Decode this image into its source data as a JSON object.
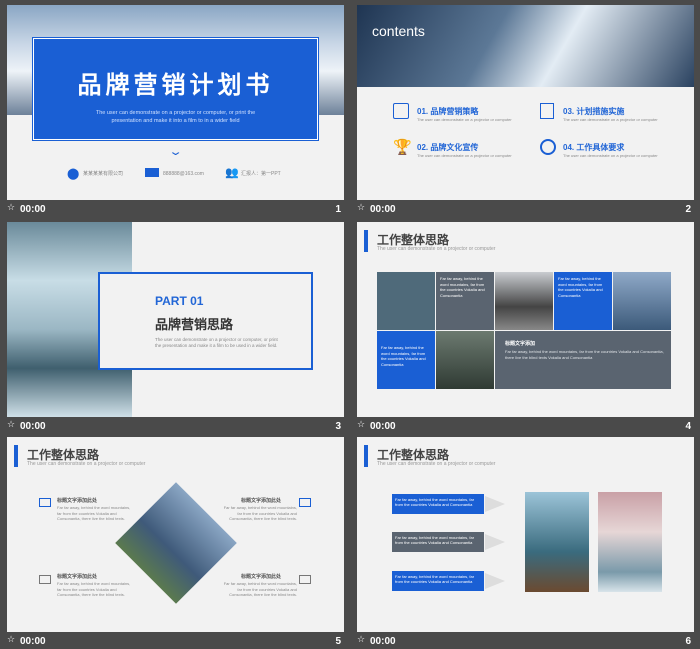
{
  "colors": {
    "accent": "#1a5fd4",
    "gray_box": "#5a6470",
    "bg": "#4a4a4a"
  },
  "slides": [
    {
      "number": "1",
      "time": "00:00",
      "title": "品牌营销计划书",
      "subtitle": "The user can demonstrate on a projector or computer, or print the presentation and make it into a film to in a wider field",
      "contact1": "某某某某有限公司",
      "contact2": "888888@163.com",
      "contact3": "汇报人：第一PPT"
    },
    {
      "number": "2",
      "time": "00:00",
      "header": "contents",
      "items": [
        {
          "label": "01. 品牌营销策略",
          "desc": "The user can demonstrate on a projector or computer"
        },
        {
          "label": "03. 计划措施实施",
          "desc": "The user can demonstrate on a projector or computer"
        },
        {
          "label": "02. 品牌文化宣传",
          "desc": "The user can demonstrate on a projector or computer"
        },
        {
          "label": "04. 工作具体要求",
          "desc": "The user can demonstrate on a projector or computer"
        }
      ]
    },
    {
      "number": "3",
      "time": "00:00",
      "part": "PART 01",
      "title": "品牌营销思路",
      "desc": "The user can demonstrate on a projector or computer, or print the presentation and make it a film to be used in a wider field."
    },
    {
      "number": "4",
      "time": "00:00",
      "title": "工作整体思路",
      "sub": "The user can demonstrate on a projector or computer",
      "text1": "Far far away, behind the word mountains, far from the countries Vokalia and Consonantia",
      "text2": "Far far away, behind the word mountains, far from the countries Vokalia and Consonantia",
      "text3": "Far far away, behind the word mountains, far from the countries Vokalia and Consonantia",
      "text4": "Far far away, behind the word mountains, far from the countries Vokalia and Consonantia",
      "label": "标题文字添加",
      "labeldesc": "Far far away, behind the word mountains, far from the countries Vokalia and Consonantia, there live the blind texts Vokalia and Consonantia"
    },
    {
      "number": "5",
      "time": "00:00",
      "title": "工作整体思路",
      "sub": "The user can demonstrate on a projector or computer",
      "blocks": [
        {
          "title": "标题文字添加此处",
          "text": "Far far away, behind the word mountains, far from the countries Vokalia and Consonantia, there live the blind texts."
        },
        {
          "title": "标题文字添加此处",
          "text": "Far far away, behind the word mountains, far from the countries Vokalia and Consonantia, there live the blind texts."
        },
        {
          "title": "标题文字添加此处",
          "text": "Far far away, behind the word mountains, far from the countries Vokalia and Consonantia, there live the blind texts."
        },
        {
          "title": "标题文字添加此处",
          "text": "Far far away, behind the word mountains, far from the countries Vokalia and Consonantia, there live the blind texts."
        }
      ]
    },
    {
      "number": "6",
      "time": "00:00",
      "title": "工作整体思路",
      "sub": "The user can demonstrate on a projector or computer",
      "boxes": [
        "Far far away, behind the word mountains, far from the countries Vokalia and Consonantia",
        "Far far away, behind the word mountains, far from the countries Vokalia and Consonantia",
        "Far far away, behind the word mountains, far from the countries Vokalia and Consonantia"
      ]
    }
  ]
}
